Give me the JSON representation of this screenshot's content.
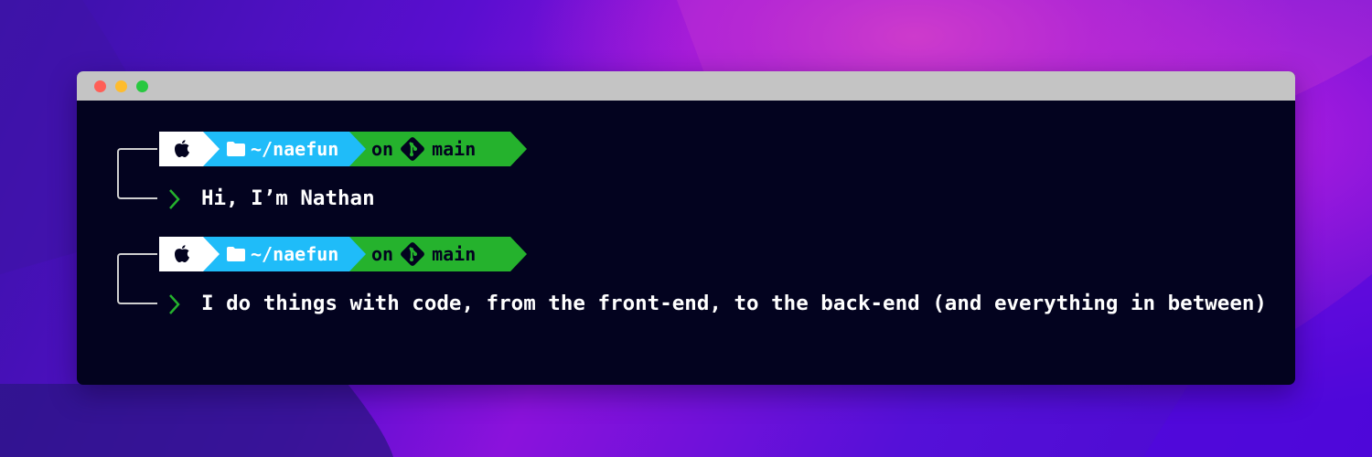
{
  "window": {
    "traffic_lights": {
      "close": "#ff5f57",
      "minimize": "#febc2e",
      "zoom": "#28c840"
    }
  },
  "colors": {
    "terminal_bg": "#03031f",
    "segment_os": "#ffffff",
    "segment_dir": "#1fbcf9",
    "segment_git": "#25b22d",
    "prompt_chevron": "#25b22d"
  },
  "prompts": [
    {
      "os_icon": "apple-icon",
      "dir_icon": "folder-icon",
      "directory": "~/naefun",
      "git_prefix": "on",
      "git_icon": "git-icon",
      "branch": "main",
      "output": "Hi, I’m Nathan"
    },
    {
      "os_icon": "apple-icon",
      "dir_icon": "folder-icon",
      "directory": "~/naefun",
      "git_prefix": "on",
      "git_icon": "git-icon",
      "branch": "main",
      "output": "I do things with code, from the front-end, to the back-end (and everything in between)"
    }
  ]
}
